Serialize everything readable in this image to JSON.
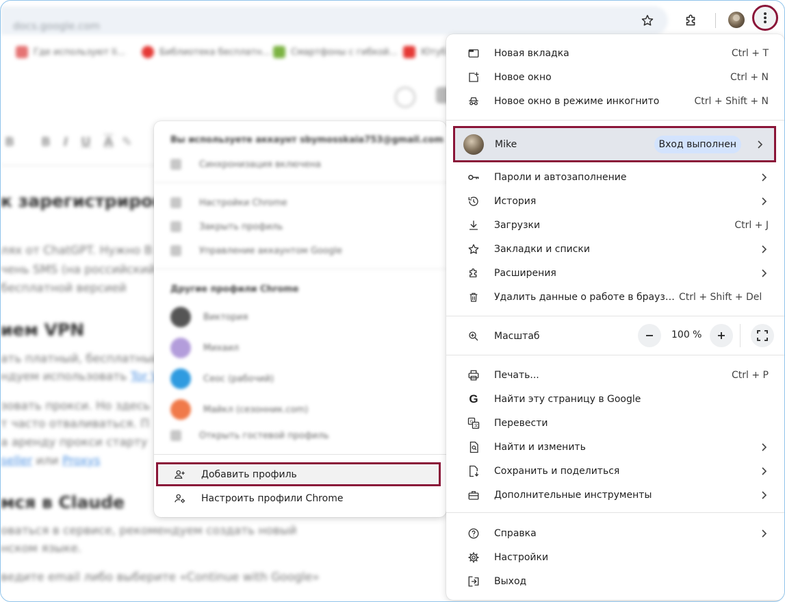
{
  "background": {
    "omnibox_text": "docs.google.com",
    "bookmarks": [
      "Где используют Ii...",
      "Библиотека бесплатн...",
      "Смартфоны с гибкой...",
      "Ютуб"
    ],
    "bookmark_colors": [
      "#e57373",
      "#e53935",
      "#7cb342",
      "#e53935"
    ],
    "heading1": "к зарегистрироваться",
    "text1": "лях от ChatGPT. Нужно В",
    "text2": "чень SMS (на российский и",
    "text3": "бесплатной версией",
    "heading2": "ием VPN",
    "text4": "ать платный, бесплатный",
    "text5": "ндуем использовать",
    "text5_link": "Tor V",
    "text6": "зовать прокси. Но здесь",
    "text7": "т часто отваливаться. П",
    "text8": "а аренду прокси старту",
    "text9_link": "seller",
    "text9_mid": " или ",
    "text9_link2": "Proxys",
    "heading3": "мся в Claude",
    "text10": "оваться в сервисе, рекомендуем создать новый",
    "text11": "нском языке.",
    "text12": "ведите email либо выберите «Continue with Google»"
  },
  "profile_menu": {
    "signed_in_as": "Вы используете аккаунт sbymosskaia753@gmail.com",
    "sync": "Синхронизация включена",
    "customize": "Настройки Chrome",
    "close_profile": "Закрыть профиль",
    "manage_account": "Управление аккаунтом Google",
    "other_profiles_title": "Другие профили Chrome",
    "other_profiles": [
      {
        "name": "Виктория",
        "color": "#555555"
      },
      {
        "name": "Михаил",
        "color": "#b39ddb"
      },
      {
        "name": "Сеос (рабочий)",
        "color": "#2f9be0"
      },
      {
        "name": "Майкл (сезонник.com)",
        "color": "#f07a4a"
      }
    ],
    "guest": "Открыть гостевой профиль",
    "add_profile": "Добавить профиль",
    "manage_profiles": "Настроить профили Chrome"
  },
  "menu": {
    "new_tab": {
      "label": "Новая вкладка",
      "shortcut": "Ctrl + T"
    },
    "new_window": {
      "label": "Новое окно",
      "shortcut": "Ctrl + N"
    },
    "incognito": {
      "label": "Новое окно в режиме инкогнито",
      "shortcut": "Ctrl + Shift + N"
    },
    "profile": {
      "name": "Mike",
      "status": "Вход выполнен"
    },
    "passwords": {
      "label": "Пароли и автозаполнение"
    },
    "history": {
      "label": "История"
    },
    "downloads": {
      "label": "Загрузки",
      "shortcut": "Ctrl + J"
    },
    "bookmarks": {
      "label": "Закладки и списки"
    },
    "extensions": {
      "label": "Расширения"
    },
    "clear_data": {
      "label": "Удалить данные о работе в браузере...",
      "shortcut": "Ctrl + Shift + Del"
    },
    "zoom": {
      "label": "Масштаб",
      "value": "100 %"
    },
    "print": {
      "label": "Печать...",
      "shortcut": "Ctrl + P"
    },
    "google_search": {
      "label": "Найти эту страницу в Google"
    },
    "translate": {
      "label": "Перевести"
    },
    "find": {
      "label": "Найти и изменить"
    },
    "save_share": {
      "label": "Сохранить и поделиться"
    },
    "more_tools": {
      "label": "Дополнительные инструменты"
    },
    "help": {
      "label": "Справка"
    },
    "settings": {
      "label": "Настройки"
    },
    "exit": {
      "label": "Выход"
    }
  },
  "colors": {
    "highlight_border": "#8a1538",
    "badge_bg": "#d3e3fd",
    "profile_row_bg": "#e3e6ec"
  }
}
